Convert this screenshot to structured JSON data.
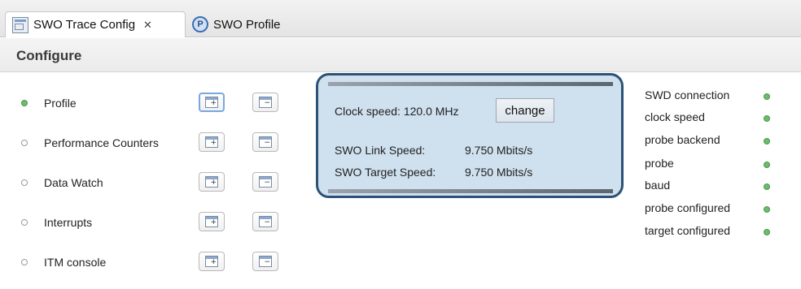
{
  "tabs": [
    {
      "label": "SWO Trace Config",
      "close_glyph": "✕",
      "icon": "swo-config-icon"
    },
    {
      "label": "SWO Profile",
      "icon": "swo-profile-icon"
    }
  ],
  "header": {
    "title": "Configure"
  },
  "features": [
    {
      "label": "Profile",
      "enabled": true
    },
    {
      "label": "Performance Counters",
      "enabled": false
    },
    {
      "label": "Data Watch",
      "enabled": false
    },
    {
      "label": "Interrupts",
      "enabled": false
    },
    {
      "label": "ITM console",
      "enabled": false
    }
  ],
  "panel": {
    "clock_label": "Clock speed: 120.0 MHz",
    "change_label": "change",
    "link_speed_label": "SWO Link Speed:",
    "link_speed_value": "9.750 Mbits/s",
    "target_speed_label": "SWO Target Speed:",
    "target_speed_value": "9.750 Mbits/s"
  },
  "status": [
    {
      "label": "SWD connection",
      "ok": true
    },
    {
      "label": "clock speed",
      "ok": true
    },
    {
      "label": "probe backend",
      "ok": true
    },
    {
      "label": "probe",
      "ok": true
    },
    {
      "label": "baud",
      "ok": true
    },
    {
      "label": "probe configured",
      "ok": true
    },
    {
      "label": "target configured",
      "ok": true
    }
  ],
  "colors": {
    "status_ok": "#6dbb6d",
    "panel_border": "#2d5275",
    "panel_bg": "#cfe0ee"
  }
}
